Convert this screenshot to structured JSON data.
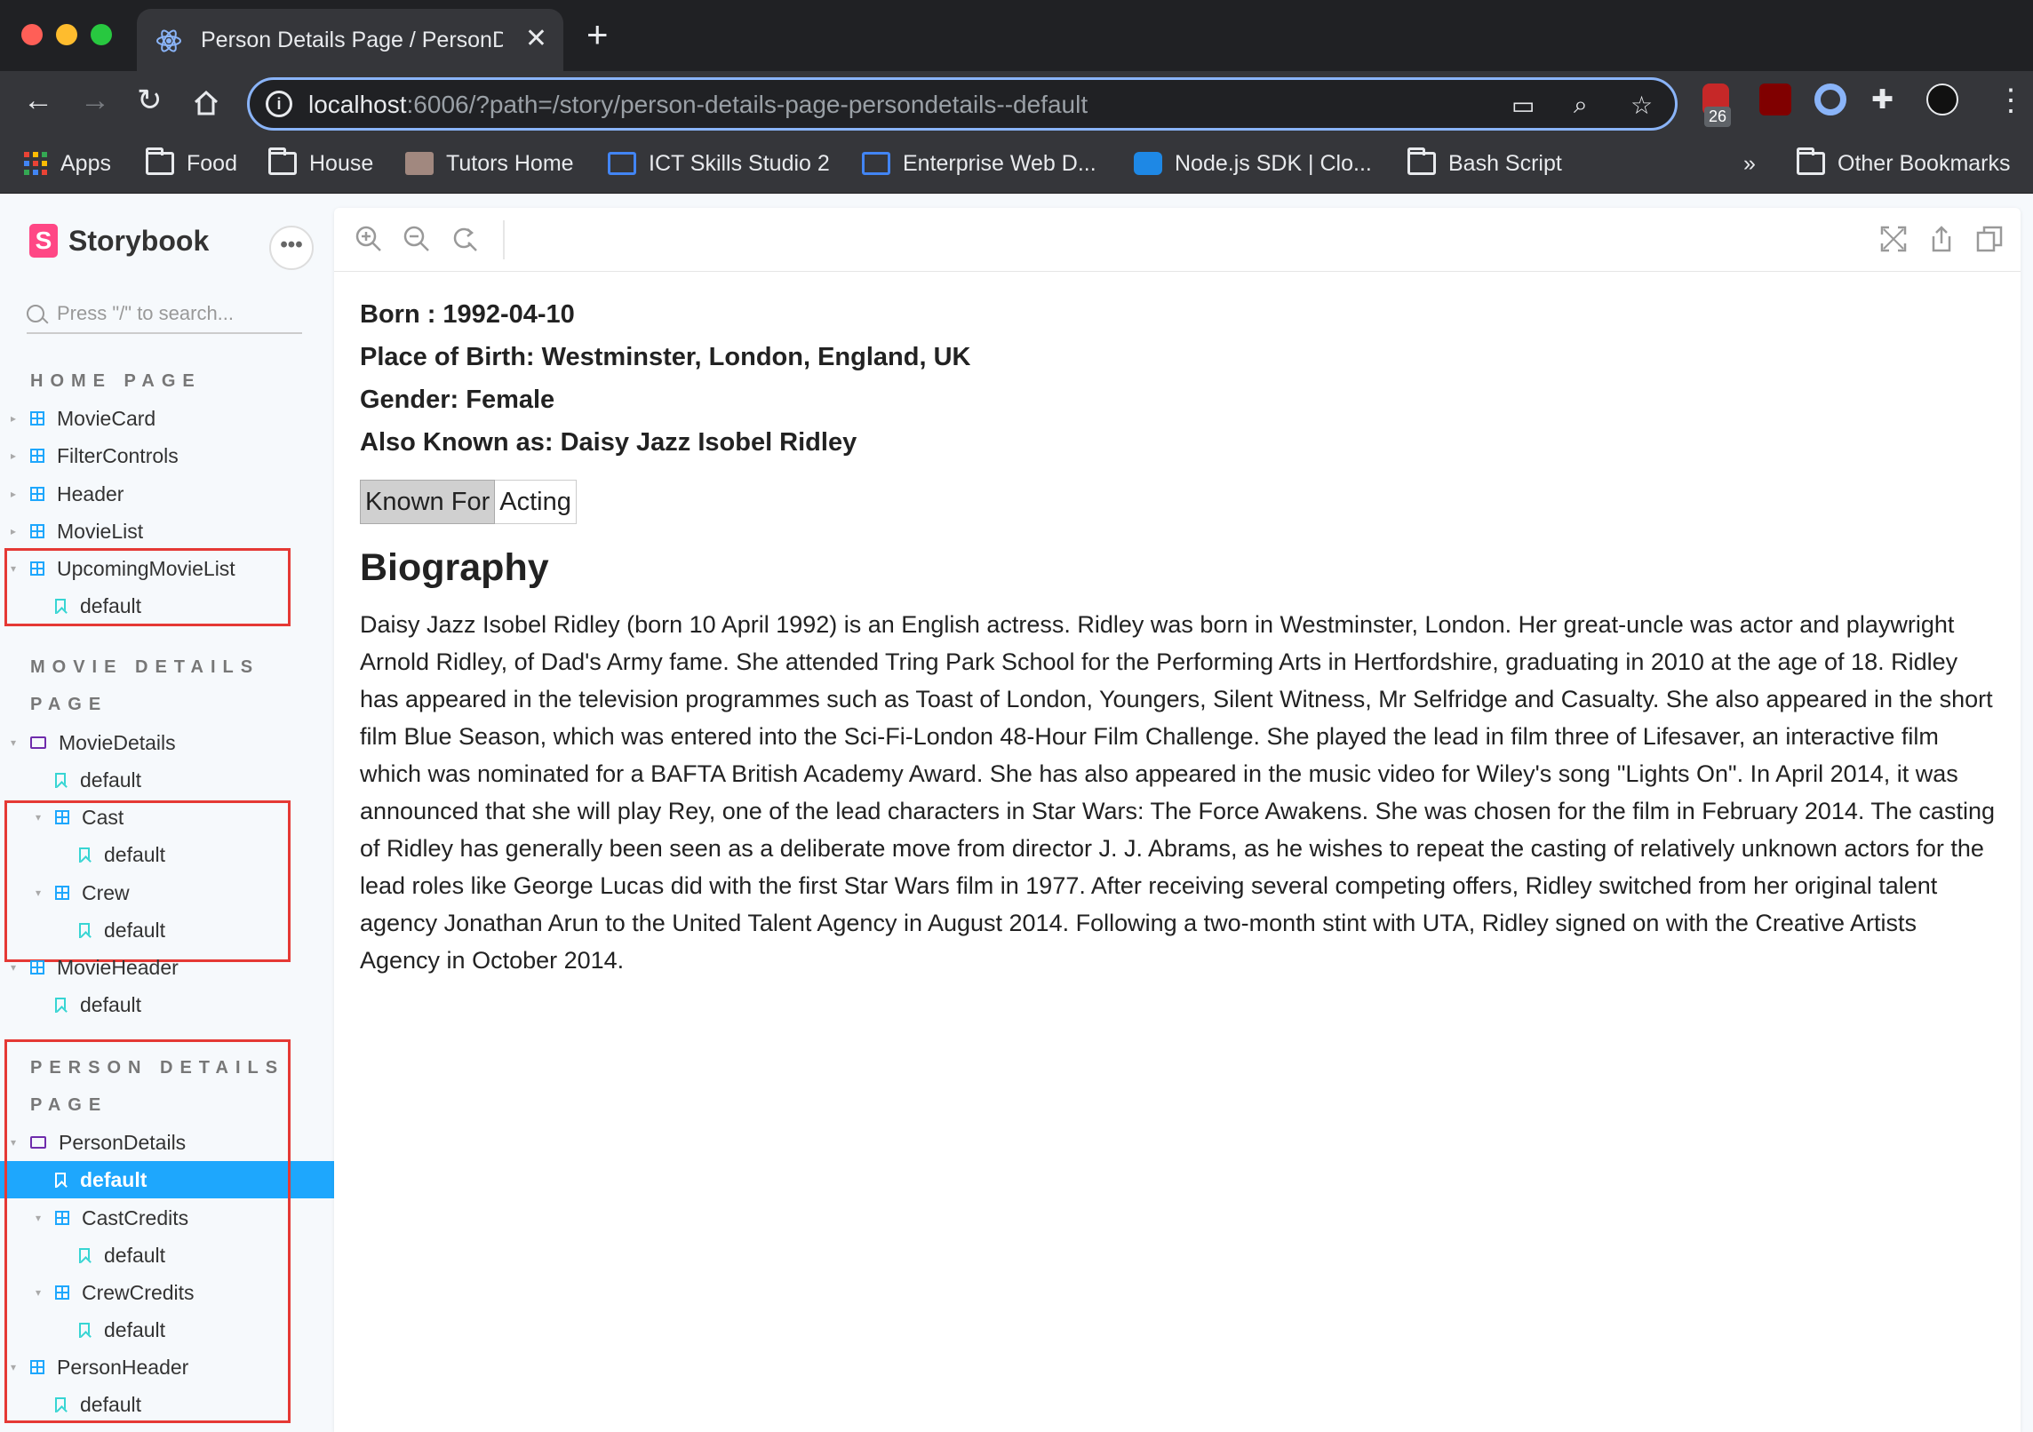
{
  "browser": {
    "tab_title": "Person Details Page / PersonDetails - Default ⋅ Storybook",
    "url_host": "localhost",
    "url_rest": ":6006/?path=/story/person-details-page-persondetails--default",
    "extension_badge": "26",
    "bookmarks": [
      {
        "label": "Apps",
        "icon": "apps-grid-icon"
      },
      {
        "label": "Food",
        "icon": "folder-icon"
      },
      {
        "label": "House",
        "icon": "folder-icon"
      },
      {
        "label": "Tutors Home",
        "icon": "site-icon"
      },
      {
        "label": "ICT Skills Studio 2",
        "icon": "site-icon"
      },
      {
        "label": "Enterprise Web D...",
        "icon": "site-icon"
      },
      {
        "label": "Node.js SDK | Clo...",
        "icon": "cloud-icon"
      },
      {
        "label": "Bash Script",
        "icon": "folder-icon"
      }
    ],
    "overflow_label": "»",
    "other_bookmarks": "Other Bookmarks"
  },
  "sidebar": {
    "brand": "Storybook",
    "search_placeholder": "Press \"/\" to search...",
    "sections": {
      "home": "HOME PAGE",
      "movie_line1": "MOVIE DETAILS",
      "movie_line2": "PAGE",
      "person_line1": "PERSON DETAILS",
      "person_line2": "PAGE"
    },
    "items": {
      "moviecard": "MovieCard",
      "filtercontrols": "FilterControls",
      "header": "Header",
      "movielist": "MovieList",
      "upcoming": "UpcomingMovieList",
      "upcoming_default": "default",
      "moviedetails": "MovieDetails",
      "moviedetails_default": "default",
      "cast": "Cast",
      "cast_default": "default",
      "crew": "Crew",
      "crew_default": "default",
      "movieheader": "MovieHeader",
      "movieheader_default": "default",
      "persondetails": "PersonDetails",
      "persondetails_default": "default",
      "castcredits": "CastCredits",
      "castcredits_default": "default",
      "crewcredits": "CrewCredits",
      "crewcredits_default": "default",
      "personheader": "PersonHeader",
      "personheader_default": "default"
    }
  },
  "person": {
    "born": "Born : 1992-04-10",
    "place_of_birth": "Place of Birth: Westminster, London, England, UK",
    "gender": "Gender: Female",
    "also_known_as": "Also Known as: Daisy Jazz Isobel Ridley",
    "known_for_label": "Known For",
    "known_for_value": "Acting",
    "biography_heading": "Biography",
    "biography_text": "Daisy Jazz Isobel Ridley (born 10 April 1992) is an English actress. Ridley was born in Westminster, London. Her great-uncle was actor and playwright Arnold Ridley, of Dad's Army fame. She attended Tring Park School for the Performing Arts in Hertfordshire, graduating in 2010 at the age of 18. Ridley has appeared in the television programmes such as Toast of London, Youngers, Silent Witness, Mr Selfridge and Casualty. She also appeared in the short film Blue Season, which was entered into the Sci-Fi-London 48-Hour Film Challenge. She played the lead in film three of Lifesaver, an interactive film which was nominated for a BAFTA British Academy Award. She has also appeared in the music video for Wiley's song \"Lights On\". In April 2014, it was announced that she will play Rey, one of the lead characters in Star Wars: The Force Awakens. She was chosen for the film in February 2014. The casting of Ridley has generally been seen as a deliberate move from director J. J. Abrams, as he wishes to repeat the casting of relatively unknown actors for the lead roles like George Lucas did with the first Star Wars film in 1977. After receiving several competing offers, Ridley switched from her original talent agency Jonathan Arun to the United Talent Agency in August 2014. Following a two-month stint with UTA, Ridley signed on with the Creative Artists Agency in October 2014."
  },
  "colors": {
    "storybook_pink": "#ff4785",
    "storybook_blue": "#1ea7fd",
    "annotation_red": "#e53935"
  }
}
